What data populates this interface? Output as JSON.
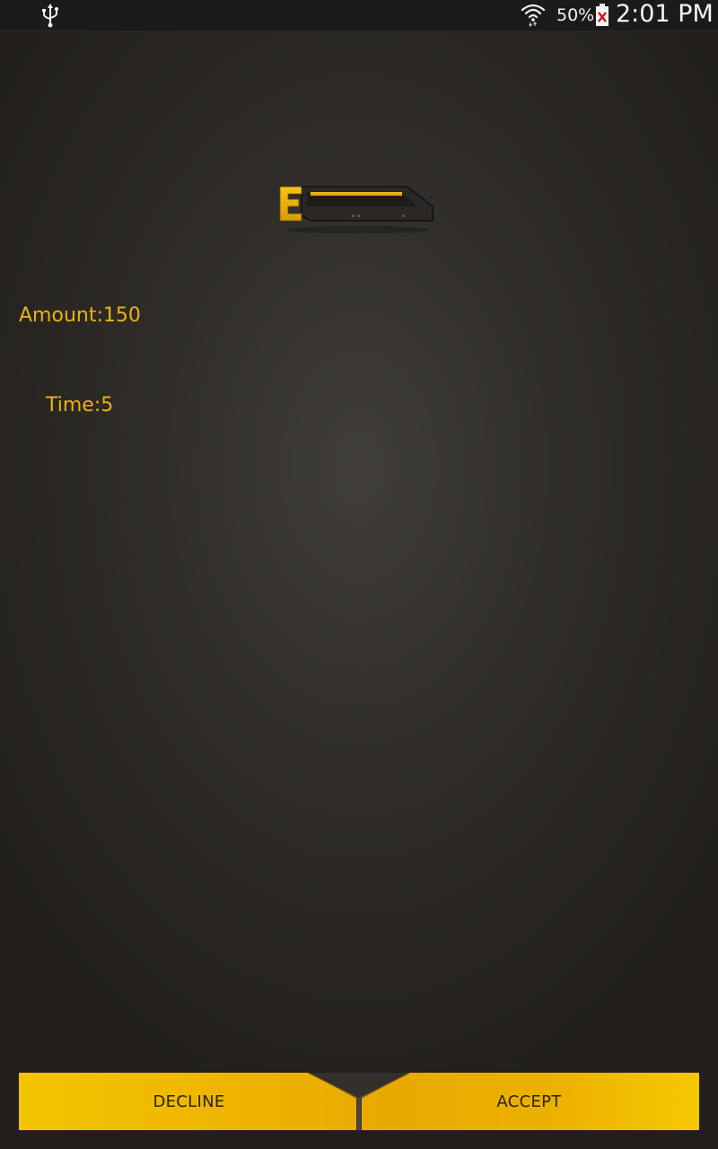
{
  "status_bar": {
    "usb_icon": "usb-icon",
    "wifi_icon": "wifi-icon",
    "battery_percent": "50%",
    "battery_icon": "battery-alert-icon",
    "time": "2:01 PM"
  },
  "logo": {
    "letter": "E",
    "accent_color": "#e8b410"
  },
  "details": {
    "amount_label": "Amount:150",
    "time_label": "Time:5"
  },
  "actions": {
    "decline_label": "DECLINE",
    "accept_label": "ACCEPT",
    "button_color": "#f0b800"
  }
}
